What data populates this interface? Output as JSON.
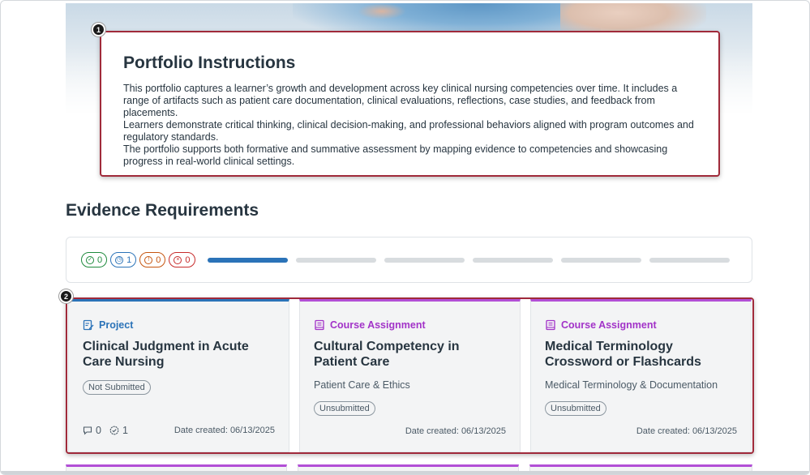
{
  "instructions": {
    "title": "Portfolio Instructions",
    "lines": [
      "This portfolio captures a learner’s growth and development across key clinical nursing competencies over time. It includes a range of artifacts such as patient care documentation, clinical evaluations, reflections, case studies, and feedback from placements.",
      "Learners demonstrate critical thinking, clinical decision-making, and professional behaviors aligned with program outcomes and regulatory standards.",
      "The portfolio supports both formative and summative assessment by mapping evidence to competencies and showcasing progress in real-world clinical settings."
    ]
  },
  "markers": {
    "one": "1",
    "two": "2"
  },
  "section": {
    "title": "Evidence Requirements"
  },
  "status_pills": [
    {
      "kind": "complete",
      "icon": "check-circle-icon",
      "count": "0",
      "color": "#1e8a3c"
    },
    {
      "kind": "in-progress",
      "icon": "clock-icon",
      "count": "1",
      "color": "#2b73b8"
    },
    {
      "kind": "warning",
      "icon": "exclamation-icon",
      "count": "0",
      "color": "#c6550f"
    },
    {
      "kind": "failed",
      "icon": "x-circle-icon",
      "count": "0",
      "color": "#c72b2b"
    }
  ],
  "progress_segments": {
    "total": 6,
    "active_index": 0,
    "active_color": "#2b73b8"
  },
  "cards": [
    {
      "type": "Project",
      "title": "Clinical Judgment in Acute Care Nursing",
      "subtitle": "",
      "status": "Not Submitted",
      "comments": "0",
      "approvals": "1",
      "date": "Date created: 06/13/2025",
      "accent": "#2b73b8"
    },
    {
      "type": "Course Assignment",
      "title": "Cultural Competency in Patient Care",
      "subtitle": "Patient Care & Ethics",
      "status": "Unsubmitted",
      "date": "Date created: 06/13/2025",
      "accent": "#b24fd6"
    },
    {
      "type": "Course Assignment",
      "title": "Medical Terminology Crossword or Flashcards",
      "subtitle": "Medical Terminology & Documentation",
      "status": "Unsubmitted",
      "date": "Date created: 06/13/2025",
      "accent": "#b24fd6"
    }
  ]
}
